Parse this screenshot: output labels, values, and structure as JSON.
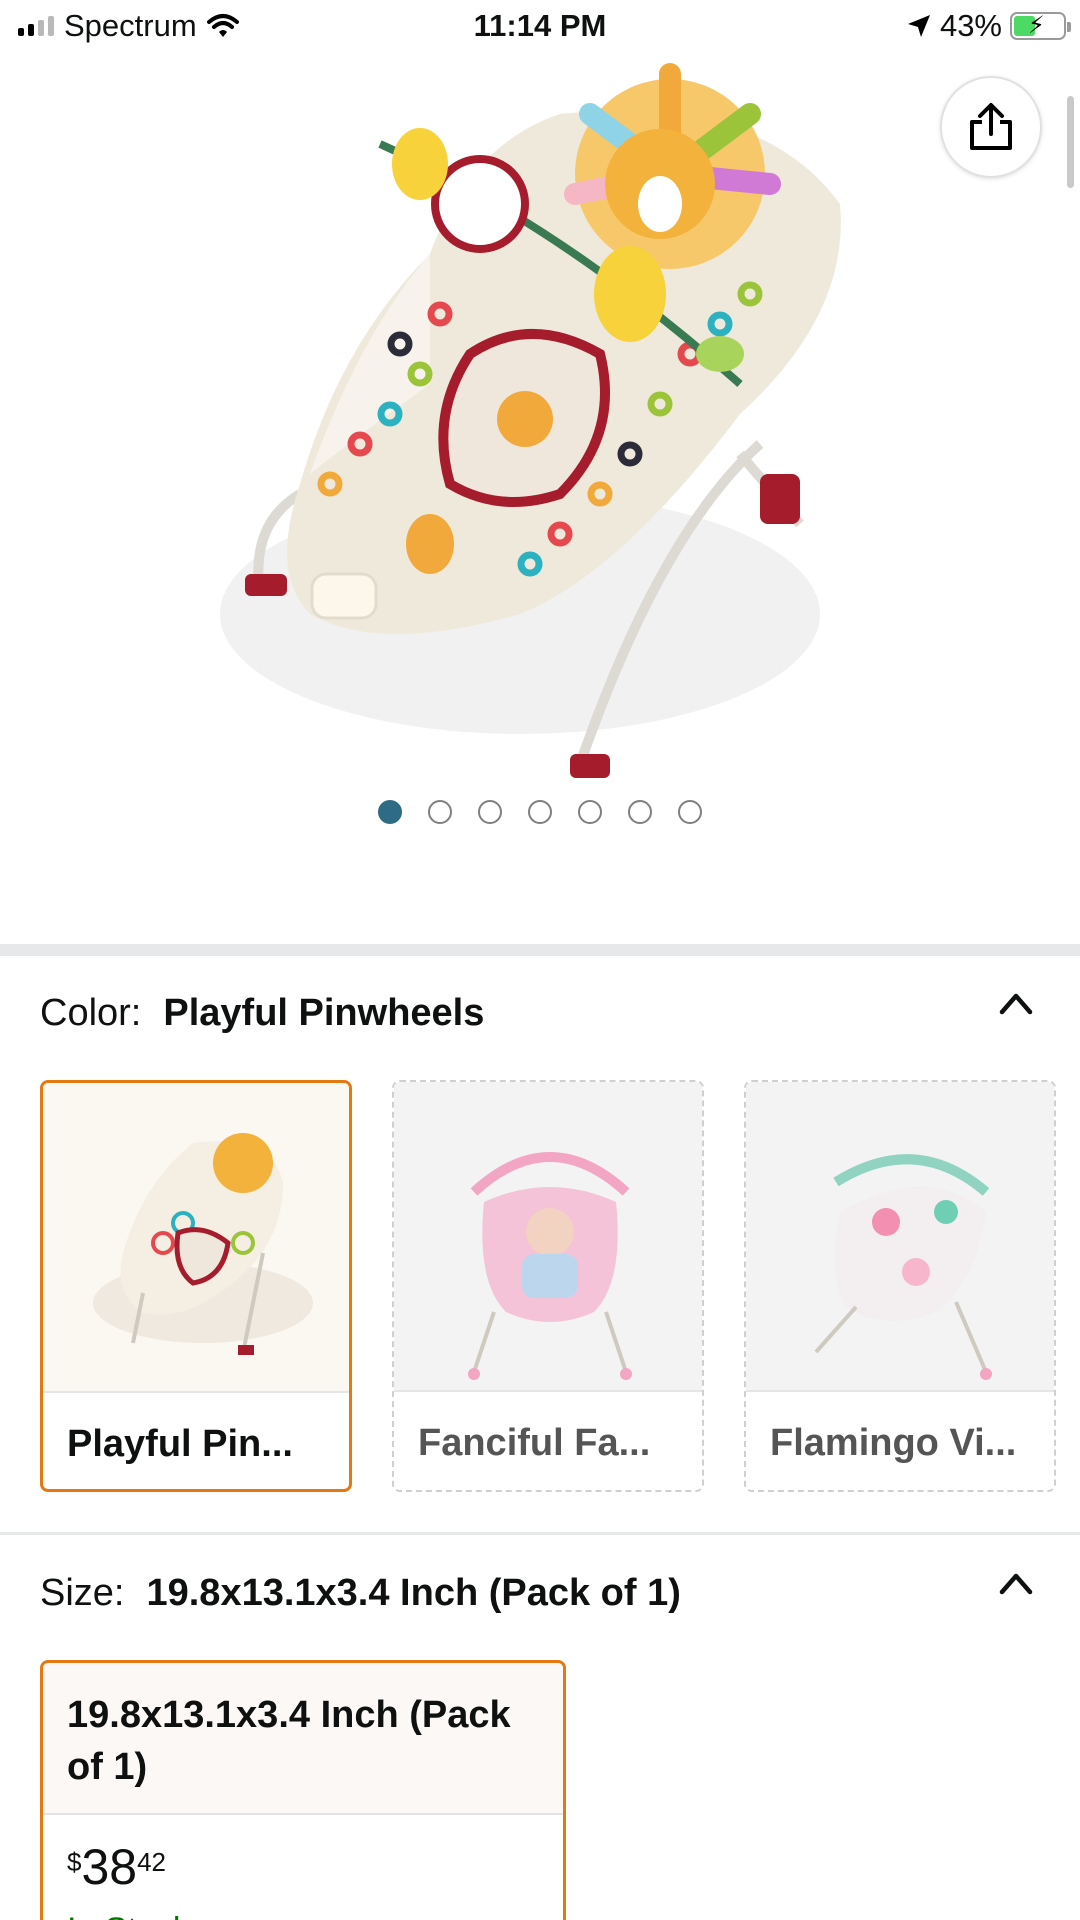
{
  "status_bar": {
    "carrier": "Spectrum",
    "time": "11:14 PM",
    "battery_percent": "43%",
    "battery_level": 0.43,
    "icons": [
      "signal-icon",
      "wifi-icon",
      "location-arrow-icon",
      "battery-charging-icon"
    ]
  },
  "hero": {
    "image_alt": "baby-bouncer-playful-pinwheels",
    "share_icon": "share-icon",
    "carousel": {
      "total": 7,
      "active_index": 0
    }
  },
  "color": {
    "label": "Color:",
    "selected": "Playful Pinwheels",
    "options": [
      {
        "label": "Playful Pin...",
        "selected": true
      },
      {
        "label": "Fanciful Fa...",
        "selected": false
      },
      {
        "label": "Flamingo Vi...",
        "selected": false
      }
    ]
  },
  "size": {
    "label": "Size:",
    "selected": "19.8x13.1x3.4 Inch (Pack of 1)",
    "card": {
      "title": "19.8x13.1x3.4 Inch (Pack of 1)",
      "price_currency": "$",
      "price_whole": "38",
      "price_fraction": "42",
      "availability": "In Stock"
    }
  },
  "colors": {
    "accent_orange": "#e47911",
    "dot_active": "#2e6b85",
    "in_stock_green": "#007600"
  }
}
